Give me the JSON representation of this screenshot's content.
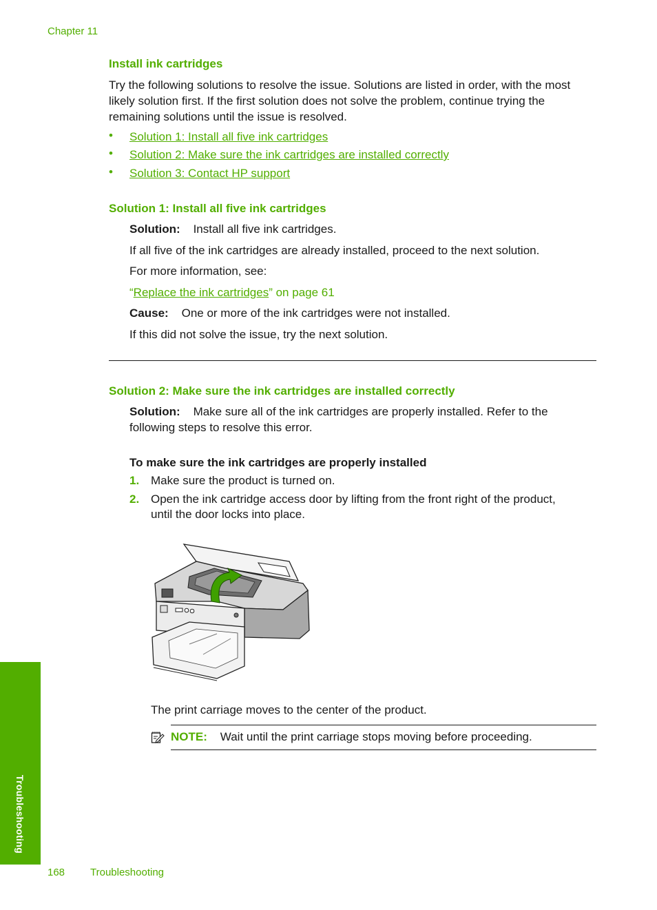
{
  "header": {
    "chapter": "Chapter 11"
  },
  "section": {
    "title": "Install ink cartridges",
    "intro": "Try the following solutions to resolve the issue. Solutions are listed in order, with the most likely solution first. If the first solution does not solve the problem, continue trying the remaining solutions until the issue is resolved.",
    "intro_lines": [
      "Try the following solutions to resolve the issue. Solutions are listed in order, with the most",
      "likely solution first. If the first solution does not solve the problem, continue trying the",
      "remaining solutions until the issue is resolved."
    ],
    "links": [
      {
        "bullet": "•",
        "label": "Solution 1: Install all five ink cartridges"
      },
      {
        "bullet": "•",
        "label": "Solution 2: Make sure the ink cartridges are installed correctly"
      },
      {
        "bullet": "•",
        "label": "Solution 3: Contact HP support"
      }
    ]
  },
  "solution1": {
    "title": "Solution 1: Install all five ink cartridges",
    "solution_label": "Solution:",
    "solution_text": "Install all five ink cartridges.",
    "para1": "If all five of the ink cartridges are already installed, proceed to the next solution.",
    "para2": "For more information, see:",
    "xref_open_quote": "“",
    "xref_link": "Replace the ink cartridges",
    "xref_suffix": "” on page 61",
    "cause_label": "Cause:",
    "cause_text": "One or more of the ink cartridges were not installed.",
    "para3": "If this did not solve the issue, try the next solution."
  },
  "solution2": {
    "title": "Solution 2: Make sure the ink cartridges are installed correctly",
    "solution_label": "Solution:",
    "solution_line1": "Make sure all of the ink cartridges are properly installed. Refer to the",
    "solution_line2": "following steps to resolve this error.",
    "procedure_title": "To make sure the ink cartridges are properly installed",
    "steps": [
      {
        "num": "1.",
        "lines": [
          "Make sure the product is turned on."
        ]
      },
      {
        "num": "2.",
        "lines": [
          "Open the ink cartridge access door by lifting from the front right of the product,",
          "until the door locks into place."
        ]
      }
    ],
    "figure_alt": "Printer with ink cartridge access door lifted open",
    "after_figure": "The print carriage moves to the center of the product.",
    "note_label": "NOTE:",
    "note_text": "Wait until the print carriage stops moving before proceeding."
  },
  "sidebar": {
    "tab_label": "Troubleshooting"
  },
  "footer": {
    "page_number": "168",
    "section": "Troubleshooting"
  },
  "colors": {
    "accent": "#52ae00",
    "text": "#1a1a1a",
    "arrow": "#3fa000"
  }
}
